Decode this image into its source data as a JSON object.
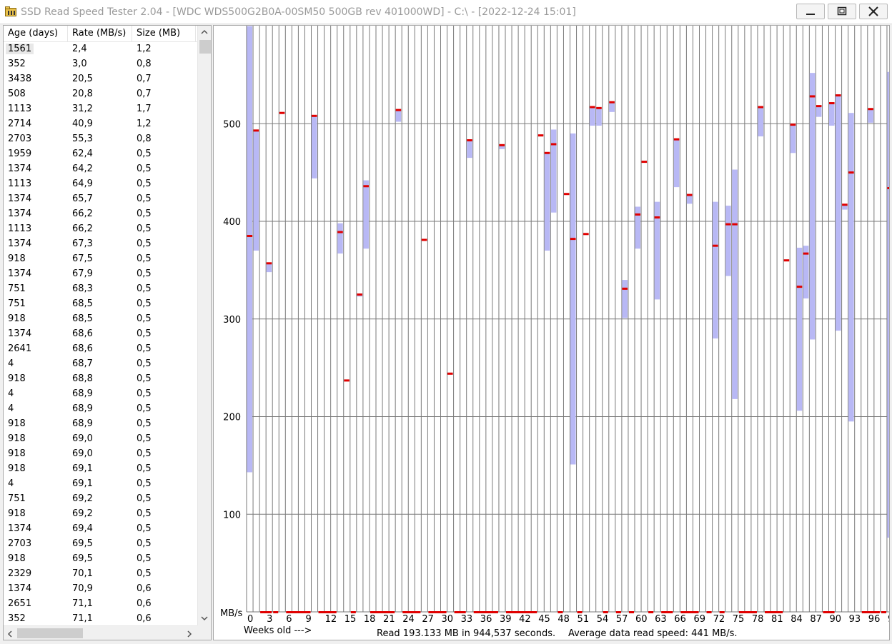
{
  "window": {
    "title": "SSD Read Speed Tester 2.04 - [WDC  WDS500G2B0A-00SM50 500GB rev 401000WD] - C:\\ - [2022-12-24 15:01]",
    "icon": "folder-icon",
    "controls": [
      "minimize-icon",
      "maximize-icon",
      "close-icon"
    ]
  },
  "list": {
    "columns": [
      "Age (days)",
      "Rate (MB/s)",
      "Size (MB)"
    ],
    "selected_row": 0,
    "rows": [
      [
        "1561",
        "2,4",
        "1,2"
      ],
      [
        "352",
        "3,0",
        "0,8"
      ],
      [
        "3438",
        "20,5",
        "0,7"
      ],
      [
        "508",
        "20,8",
        "0,7"
      ],
      [
        "1113",
        "31,2",
        "1,7"
      ],
      [
        "2714",
        "40,9",
        "1,2"
      ],
      [
        "2703",
        "55,3",
        "0,8"
      ],
      [
        "1959",
        "62,4",
        "0,5"
      ],
      [
        "1374",
        "64,2",
        "0,5"
      ],
      [
        "1113",
        "64,9",
        "0,5"
      ],
      [
        "1374",
        "65,7",
        "0,5"
      ],
      [
        "1374",
        "66,2",
        "0,5"
      ],
      [
        "1113",
        "66,2",
        "0,5"
      ],
      [
        "1374",
        "67,3",
        "0,5"
      ],
      [
        "918",
        "67,5",
        "0,5"
      ],
      [
        "1374",
        "67,9",
        "0,5"
      ],
      [
        "751",
        "68,3",
        "0,5"
      ],
      [
        "751",
        "68,5",
        "0,5"
      ],
      [
        "918",
        "68,5",
        "0,5"
      ],
      [
        "1374",
        "68,6",
        "0,5"
      ],
      [
        "2641",
        "68,6",
        "0,5"
      ],
      [
        "4",
        "68,7",
        "0,5"
      ],
      [
        "918",
        "68,8",
        "0,5"
      ],
      [
        "4",
        "68,9",
        "0,5"
      ],
      [
        "4",
        "68,9",
        "0,5"
      ],
      [
        "918",
        "68,9",
        "0,5"
      ],
      [
        "918",
        "69,0",
        "0,5"
      ],
      [
        "918",
        "69,0",
        "0,5"
      ],
      [
        "918",
        "69,1",
        "0,5"
      ],
      [
        "4",
        "69,1",
        "0,5"
      ],
      [
        "751",
        "69,2",
        "0,5"
      ],
      [
        "918",
        "69,2",
        "0,5"
      ],
      [
        "1374",
        "69,4",
        "0,5"
      ],
      [
        "2703",
        "69,5",
        "0,5"
      ],
      [
        "918",
        "69,5",
        "0,5"
      ],
      [
        "2329",
        "70,1",
        "0,5"
      ],
      [
        "1374",
        "70,9",
        "0,6"
      ],
      [
        "2651",
        "71,1",
        "0,6"
      ],
      [
        "352",
        "71,1",
        "0,6"
      ]
    ]
  },
  "chart_data": {
    "type": "bar",
    "ylabel": "MB/s",
    "xlabel": "Weeks old --->",
    "ylim": [
      0,
      600
    ],
    "yticks": [
      100,
      200,
      300,
      400,
      500
    ],
    "xticks": [
      0,
      3,
      6,
      9,
      12,
      15,
      18,
      21,
      24,
      27,
      30,
      33,
      36,
      39,
      42,
      45,
      48,
      51,
      54,
      57,
      60,
      63,
      66,
      69,
      72,
      75,
      78,
      81,
      84,
      87,
      90,
      93,
      96,
      99
    ],
    "x_count": 100,
    "grid": true,
    "range_color": "#b8b8f5",
    "avg_color": "#e00000",
    "ranges": [
      {
        "week": 0,
        "min": 143,
        "max": 600
      },
      {
        "week": 1,
        "min": 370,
        "max": 493
      },
      {
        "week": 3,
        "min": 348,
        "max": 357
      },
      {
        "week": 10,
        "min": 444,
        "max": 508
      },
      {
        "week": 14,
        "min": 367,
        "max": 398
      },
      {
        "week": 17,
        "min": 323,
        "max": 325
      },
      {
        "week": 18,
        "min": 372,
        "max": 442
      },
      {
        "week": 23,
        "min": 502,
        "max": 514
      },
      {
        "week": 34,
        "min": 465,
        "max": 483
      },
      {
        "week": 39,
        "min": 474,
        "max": 478
      },
      {
        "week": 46,
        "min": 370,
        "max": 470
      },
      {
        "week": 47,
        "min": 409,
        "max": 494
      },
      {
        "week": 50,
        "min": 151,
        "max": 490
      },
      {
        "week": 53,
        "min": 498,
        "max": 517
      },
      {
        "week": 54,
        "min": 498,
        "max": 516
      },
      {
        "week": 56,
        "min": 512,
        "max": 522
      },
      {
        "week": 58,
        "min": 301,
        "max": 340
      },
      {
        "week": 60,
        "min": 372,
        "max": 415
      },
      {
        "week": 63,
        "min": 320,
        "max": 420
      },
      {
        "week": 66,
        "min": 435,
        "max": 484
      },
      {
        "week": 68,
        "min": 418,
        "max": 427
      },
      {
        "week": 72,
        "min": 280,
        "max": 420
      },
      {
        "week": 74,
        "min": 344,
        "max": 416
      },
      {
        "week": 75,
        "min": 218,
        "max": 453
      },
      {
        "week": 79,
        "min": 487,
        "max": 517
      },
      {
        "week": 84,
        "min": 470,
        "max": 500
      },
      {
        "week": 85,
        "min": 206,
        "max": 373
      },
      {
        "week": 86,
        "min": 321,
        "max": 375
      },
      {
        "week": 87,
        "min": 279,
        "max": 552
      },
      {
        "week": 88,
        "min": 507,
        "max": 519
      },
      {
        "week": 90,
        "min": 498,
        "max": 521
      },
      {
        "week": 91,
        "min": 288,
        "max": 530
      },
      {
        "week": 92,
        "min": 412,
        "max": 417
      },
      {
        "week": 93,
        "min": 195,
        "max": 511
      },
      {
        "week": 96,
        "min": 501,
        "max": 515
      },
      {
        "week": 99,
        "min": 76,
        "max": 553
      }
    ],
    "averages": [
      {
        "week": 0,
        "value": 385
      },
      {
        "week": 1,
        "value": 493
      },
      {
        "week": 3,
        "value": 357
      },
      {
        "week": 5,
        "value": 511
      },
      {
        "week": 10,
        "value": 508
      },
      {
        "week": 14,
        "value": 389
      },
      {
        "week": 15,
        "value": 237
      },
      {
        "week": 17,
        "value": 325
      },
      {
        "week": 18,
        "value": 436
      },
      {
        "week": 23,
        "value": 514
      },
      {
        "week": 27,
        "value": 381
      },
      {
        "week": 31,
        "value": 244
      },
      {
        "week": 34,
        "value": 483
      },
      {
        "week": 39,
        "value": 478
      },
      {
        "week": 45,
        "value": 488
      },
      {
        "week": 46,
        "value": 470
      },
      {
        "week": 47,
        "value": 479
      },
      {
        "week": 49,
        "value": 428
      },
      {
        "week": 50,
        "value": 382
      },
      {
        "week": 52,
        "value": 387
      },
      {
        "week": 53,
        "value": 517
      },
      {
        "week": 54,
        "value": 516
      },
      {
        "week": 56,
        "value": 522
      },
      {
        "week": 58,
        "value": 331
      },
      {
        "week": 60,
        "value": 407
      },
      {
        "week": 61,
        "value": 461
      },
      {
        "week": 63,
        "value": 404
      },
      {
        "week": 66,
        "value": 484
      },
      {
        "week": 68,
        "value": 427
      },
      {
        "week": 72,
        "value": 375
      },
      {
        "week": 74,
        "value": 397
      },
      {
        "week": 75,
        "value": 397
      },
      {
        "week": 79,
        "value": 517
      },
      {
        "week": 83,
        "value": 360
      },
      {
        "week": 84,
        "value": 499
      },
      {
        "week": 85,
        "value": 333
      },
      {
        "week": 86,
        "value": 367
      },
      {
        "week": 87,
        "value": 528
      },
      {
        "week": 88,
        "value": 518
      },
      {
        "week": 90,
        "value": 521
      },
      {
        "week": 91,
        "value": 529
      },
      {
        "week": 92,
        "value": 417
      },
      {
        "week": 93,
        "value": 450
      },
      {
        "week": 96,
        "value": 515
      },
      {
        "week": 99,
        "value": 434
      }
    ],
    "baseline_marks": [
      [
        2,
        3
      ],
      [
        4,
        4
      ],
      [
        6,
        9
      ],
      [
        11,
        13
      ],
      [
        16,
        16
      ],
      [
        19,
        22
      ],
      [
        24,
        26
      ],
      [
        28,
        30
      ],
      [
        32,
        33
      ],
      [
        35,
        38
      ],
      [
        40,
        44
      ],
      [
        48,
        48
      ],
      [
        51,
        51
      ],
      [
        55,
        55
      ],
      [
        57,
        57
      ],
      [
        59,
        59
      ],
      [
        62,
        62
      ],
      [
        64,
        65
      ],
      [
        67,
        69
      ],
      [
        71,
        71
      ],
      [
        73,
        73
      ],
      [
        76,
        78
      ],
      [
        80,
        82
      ],
      [
        89,
        90
      ],
      [
        95,
        97
      ],
      [
        98,
        98
      ]
    ],
    "status_text": "Read 193.133 MB in 944,537 seconds.",
    "avg_speed_text": "Average data read speed: 441 MB/s."
  }
}
